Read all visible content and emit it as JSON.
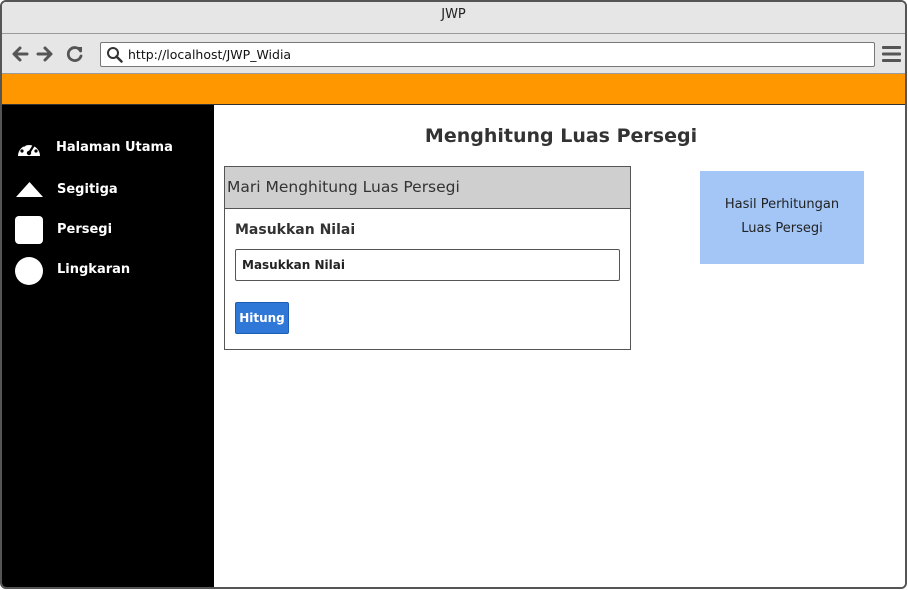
{
  "window": {
    "title": "JWP"
  },
  "browser": {
    "url": "http://localhost/JWP_Widia"
  },
  "sidebar": {
    "items": [
      {
        "label": "Halaman Utama",
        "icon": "dashboard-icon"
      },
      {
        "label": "Segitiga",
        "icon": "triangle-icon"
      },
      {
        "label": "Persegi",
        "icon": "square-icon"
      },
      {
        "label": "Lingkaran",
        "icon": "circle-icon"
      }
    ]
  },
  "main": {
    "title": "Menghitung Luas Persegi",
    "panel": {
      "header": "Mari Menghitung Luas Persegi",
      "field_label": "Masukkan Nilai",
      "input_placeholder": "Masukkan Nilai",
      "button_label": "Hitung"
    },
    "result": {
      "line1": "Hasil Perhitungan",
      "line2": "Luas Persegi"
    }
  },
  "colors": {
    "accent_bar": "#ff9800",
    "sidebar_bg": "#000000",
    "button_bg": "#2f78d8",
    "result_bg": "#a3c6f7",
    "panel_header_bg": "#cfcfcf"
  }
}
